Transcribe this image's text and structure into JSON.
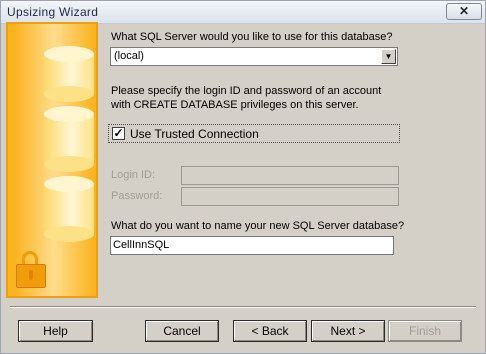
{
  "window": {
    "title": "Upsizing Wizard",
    "close_glyph": "✕"
  },
  "banner": {
    "icon": "database-lock-illustration"
  },
  "server": {
    "question": "What SQL Server would you like to use for this database?",
    "selected": "(local)",
    "arrow_glyph": "▼"
  },
  "login_note": {
    "line1": "Please specify the login ID and password of an account",
    "line2": "with CREATE DATABASE privileges on this server."
  },
  "trusted": {
    "label": "Use Trusted Connection",
    "checked": true,
    "check_glyph": "✓"
  },
  "credentials": {
    "login_label": "Login ID:",
    "login_value": "",
    "password_label": "Password:",
    "password_value": ""
  },
  "database": {
    "question": "What do you want to name your new SQL Server database?",
    "value": "CellInnSQL"
  },
  "buttons": {
    "help": "Help",
    "cancel": "Cancel",
    "back": "< Back",
    "next": "Next >",
    "finish": "Finish"
  },
  "colors": {
    "banner": "#fcb31e",
    "dialog": "#d4d0c8",
    "disabled_text": "#a19d95"
  }
}
